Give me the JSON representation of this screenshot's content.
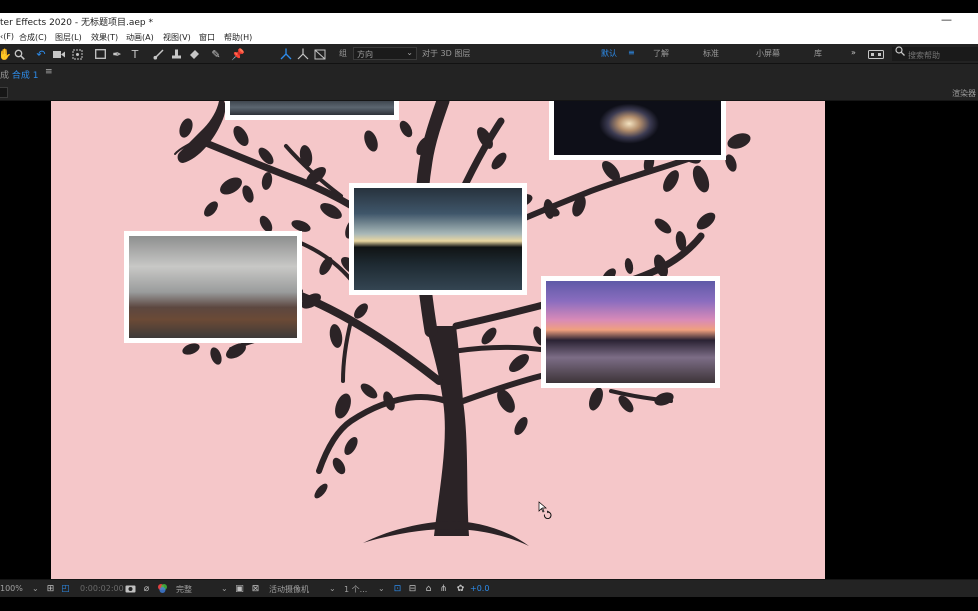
{
  "window": {
    "title": "ter Effects 2020 - 无标题项目.aep *",
    "minimize_glyph": "—"
  },
  "menu": [
    {
      "label": "‹(F)"
    },
    {
      "label": "合成(C)"
    },
    {
      "label": "图层(L)"
    },
    {
      "label": "效果(T)"
    },
    {
      "label": "动画(A)"
    },
    {
      "label": "视图(V)"
    },
    {
      "label": "窗口"
    },
    {
      "label": "帮助(H)"
    }
  ],
  "toolbar": {
    "axis_label": "组",
    "axis_mode_value": "方向",
    "align_3d_label": "对于 3D 图层",
    "tools": [
      "hand-icon",
      "zoom-icon",
      "rotate-icon",
      "camera-icon",
      "pan-behind-icon",
      "rectangle-icon",
      "pen-icon",
      "type-icon",
      "brush-icon",
      "clone-stamp-icon",
      "eraser-icon",
      "roto-brush-icon",
      "puppet-pin-icon"
    ],
    "snap_tools": [
      "local-axis-icon",
      "world-axis-icon",
      "view-axis-icon"
    ]
  },
  "workspaces": {
    "items": [
      {
        "label": "默认",
        "active": true
      },
      {
        "label": "≡",
        "active": true
      },
      {
        "label": "了解",
        "active": false
      },
      {
        "label": "标准",
        "active": false
      },
      {
        "label": "小屏幕",
        "active": false
      },
      {
        "label": "库",
        "active": false
      }
    ],
    "overflow": "»",
    "search_placeholder": "搜索帮助"
  },
  "panel": {
    "prefix": "成",
    "comp_name": "合成 1",
    "menu_glyph": "≡",
    "renderer": "渲染器"
  },
  "bottom": {
    "zoom": "100%",
    "timecode": "0:00:02:00",
    "resolution": "完整",
    "camera": "活动摄像机",
    "views": "1 个...",
    "exposure": "+0.0"
  },
  "colors": {
    "canvas_bg": "#f5c7c9",
    "tree": "#2b2326",
    "accent": "#2d8ceb"
  }
}
